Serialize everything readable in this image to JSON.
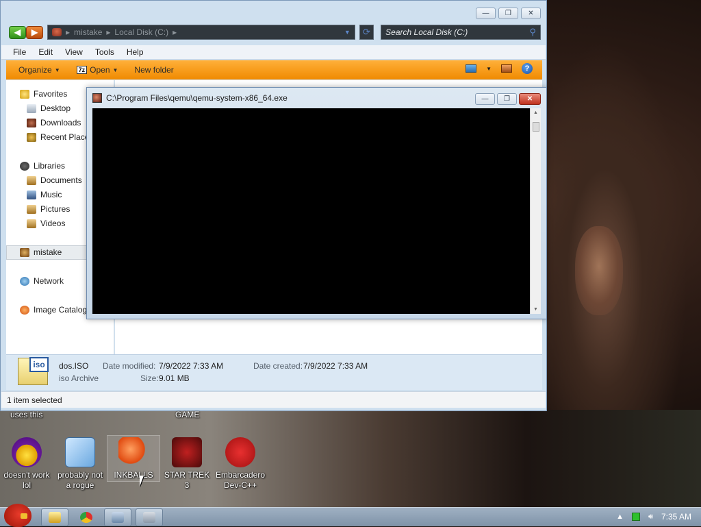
{
  "explorer": {
    "window_controls": {
      "minimize": "—",
      "maximize": "❐",
      "close": "✕"
    },
    "address": {
      "segments": [
        "mistake",
        "Local Disk (C:)"
      ],
      "sep": "▸"
    },
    "search_placeholder": "Search Local Disk (C:)",
    "menu": [
      "File",
      "Edit",
      "View",
      "Tools",
      "Help"
    ],
    "toolbar": {
      "organize": "Organize",
      "open": "Open",
      "seven_zip": "7z",
      "new_folder": "New folder",
      "help": "?"
    },
    "nav_pane": {
      "favorites": "Favorites",
      "favorites_items": [
        "Desktop",
        "Downloads",
        "Recent Places"
      ],
      "libraries": "Libraries",
      "libraries_items": [
        "Documents",
        "Music",
        "Pictures",
        "Videos"
      ],
      "user_folder": "mistake",
      "network": "Network",
      "image_catalog": "Image Catalog"
    },
    "details": {
      "file_name": "dos.ISO",
      "file_type": "iso Archive",
      "date_modified_label": "Date modified:",
      "date_modified": "7/9/2022 7:33 AM",
      "date_created_label": "Date created:",
      "date_created": "7/9/2022 7:33 AM",
      "size_label": "Size:",
      "size": "9.01 MB",
      "icon_tag": "iso"
    },
    "status": "1 item selected"
  },
  "qemu": {
    "title": "C:\\Program Files\\qemu\\qemu-system-x86_64.exe",
    "controls": {
      "minimize": "—",
      "maximize": "❐",
      "close": "✕"
    }
  },
  "desktop": {
    "captions_top": [
      "uses this",
      "GAME"
    ],
    "icons": [
      {
        "label": "doesn't work lol"
      },
      {
        "label": "probably not a rogue"
      },
      {
        "label": "INKBALLS"
      },
      {
        "label": "STAR TREK 3"
      },
      {
        "label": "Embarcadero Dev-C++"
      }
    ]
  },
  "taskbar": {
    "clock": "7:35 AM"
  }
}
